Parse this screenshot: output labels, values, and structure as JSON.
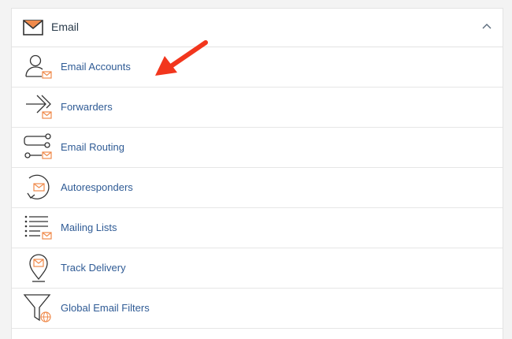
{
  "section": {
    "title": "Email",
    "icon": "envelope-icon",
    "collapse_icon": "chevron-up-icon"
  },
  "items": [
    {
      "label": "Email Accounts",
      "icon": "user-envelope-icon"
    },
    {
      "label": "Forwarders",
      "icon": "forward-arrows-icon"
    },
    {
      "label": "Email Routing",
      "icon": "routing-icon"
    },
    {
      "label": "Autoresponders",
      "icon": "autoresponder-icon"
    },
    {
      "label": "Mailing Lists",
      "icon": "mailing-list-icon"
    },
    {
      "label": "Track Delivery",
      "icon": "location-pin-envelope-icon"
    },
    {
      "label": "Global Email Filters",
      "icon": "filter-globe-icon"
    }
  ],
  "colors": {
    "link": "#2f5b95",
    "accent": "#f08a4b",
    "icon_stroke": "#333333",
    "annotation_arrow": "#f2361d"
  }
}
